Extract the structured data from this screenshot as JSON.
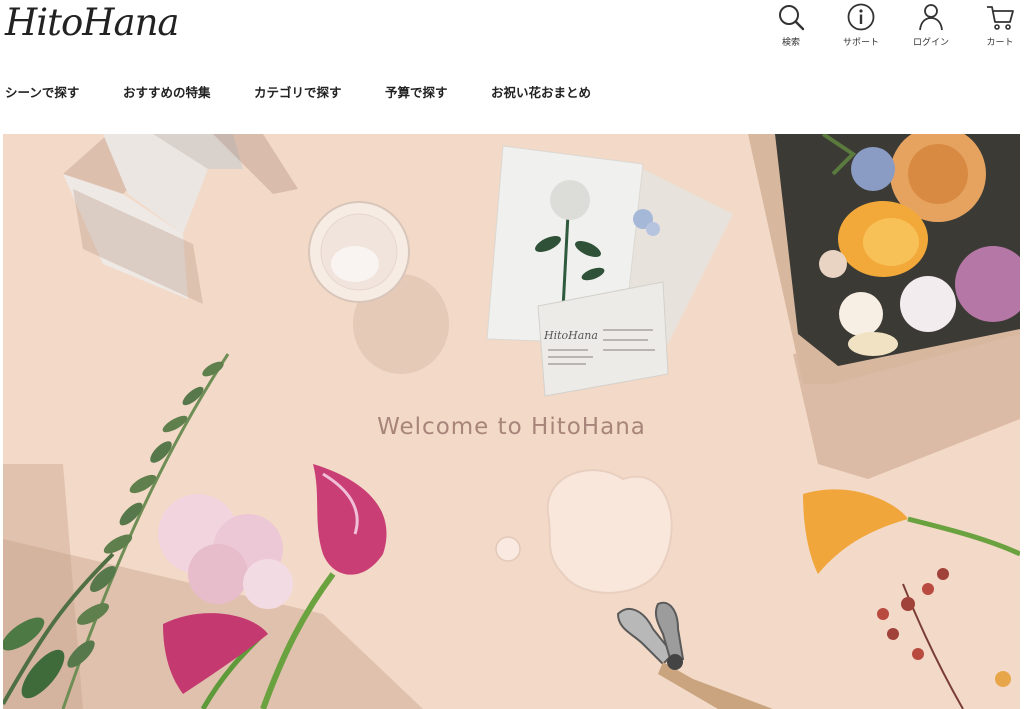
{
  "brand": {
    "logo_text": "HitoHana"
  },
  "utility_nav": [
    {
      "label": "検索",
      "icon": "search-icon"
    },
    {
      "label": "サポート",
      "icon": "info-icon"
    },
    {
      "label": "ログイン",
      "icon": "user-icon"
    },
    {
      "label": "カート",
      "icon": "cart-icon"
    }
  ],
  "main_nav": [
    {
      "label": "シーンで探す"
    },
    {
      "label": "おすすめの特集"
    },
    {
      "label": "カテゴリで探す"
    },
    {
      "label": "予算で探す"
    },
    {
      "label": "お祝い花おまとめ"
    }
  ],
  "hero": {
    "title": "Welcome to HitoHana",
    "card_logo": "HitoHana"
  },
  "colors": {
    "hero_background": "#f5ddcb",
    "hero_title": "#a8857a",
    "text": "#222222"
  }
}
